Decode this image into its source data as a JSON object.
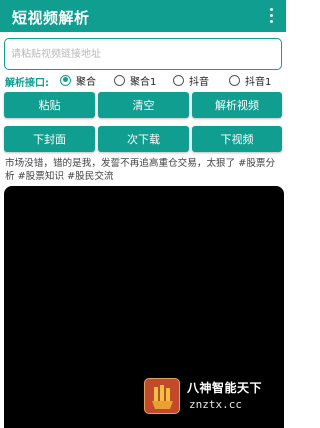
{
  "appbar": {
    "title": "短视频解析",
    "menu_icon": "more-vert-icon"
  },
  "input": {
    "placeholder": "请粘贴视频链接地址",
    "value": ""
  },
  "interface": {
    "label": "解析接口:",
    "options": [
      {
        "label": "聚合",
        "checked": true
      },
      {
        "label": "聚合1",
        "checked": false
      },
      {
        "label": "抖音",
        "checked": false
      },
      {
        "label": "抖音1",
        "checked": false
      }
    ]
  },
  "actions_row1": {
    "paste": "粘贴",
    "clear": "清空",
    "parse": "解析视频"
  },
  "actions_row2": {
    "download_cover": "下封面",
    "download_next": "次下载",
    "download_video": "下视频"
  },
  "description": "市场没错，错的是我，发誓不再追高重仓交易，太狠了 #股票分析 #股票知识 #股民交流",
  "watermark": {
    "line1": "八神智能天下",
    "line2": "znztx.cc"
  },
  "colors": {
    "accent": "#0f9e8f",
    "video_bg": "#000000"
  }
}
